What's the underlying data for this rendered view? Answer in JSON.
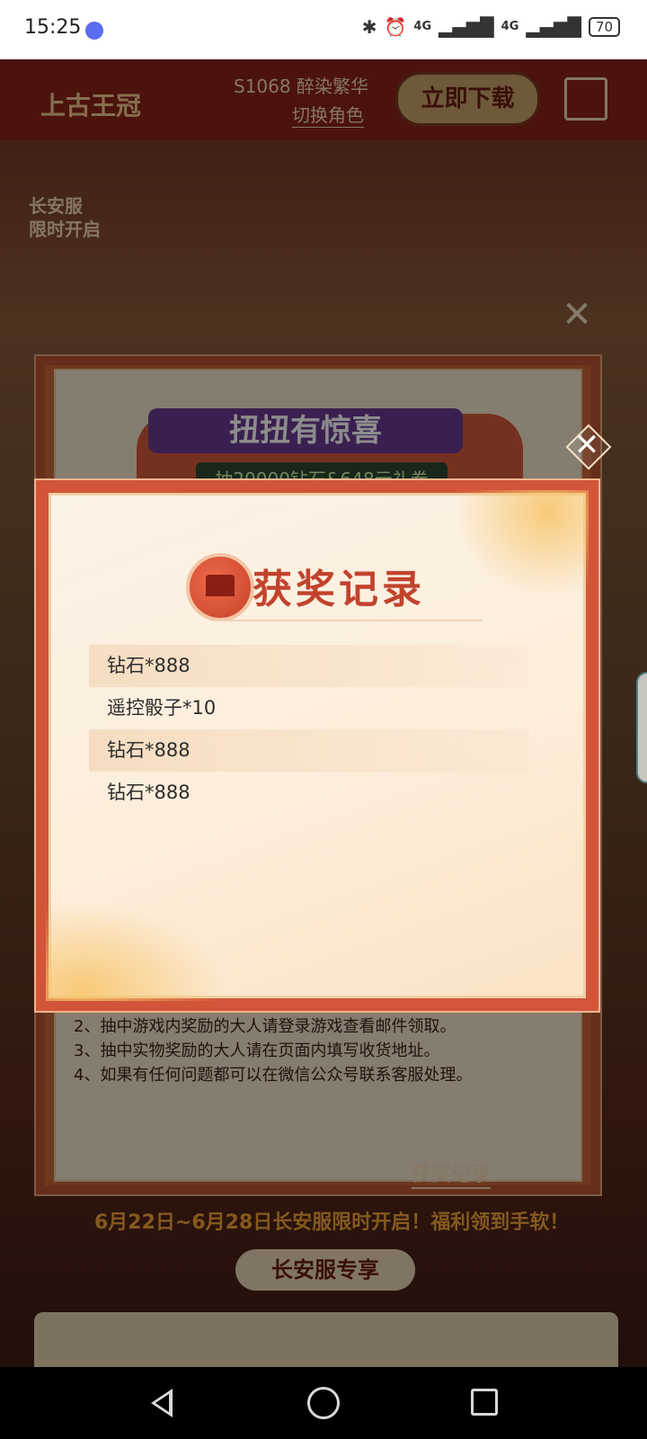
{
  "status_bar": {
    "time": "15:25",
    "battery": "70",
    "network": "4G",
    "icons": [
      "app-icon",
      "bluetooth-icon",
      "alarm-icon",
      "hd-icon",
      "signal-icon",
      "signal-icon",
      "battery-icon"
    ]
  },
  "page": {
    "logo": "上古王冠",
    "server": "S1068 醉染繁华",
    "switch_role": "切换角色",
    "download_button": "立即下载",
    "badge_line1": "长安服",
    "badge_line2": "限时开启",
    "rules": [
      "2、抽中游戏内奖励的大人请登录游戏查看邮件领取。",
      "3、抽中实物奖励的大人请在页面内填写收货地址。",
      "4、如果有任何问题都可以在微信公众号联系客服处理。"
    ],
    "record_link": "获奖记录",
    "banner": "6月22日~6月28日长安服限时开启！福利领到手软！",
    "section_title": "长安服专享"
  },
  "twist_modal": {
    "title": "扭扭有惊喜",
    "subtitle": "抽20000钻石&648元礼券"
  },
  "award_modal": {
    "title": "获奖记录",
    "records": [
      {
        "text": "钻石*888"
      },
      {
        "text": "遥控骰子*10"
      },
      {
        "text": "钻石*888"
      },
      {
        "text": "钻石*888"
      }
    ]
  },
  "colors": {
    "title_red": "#c1432c",
    "frame_red": "#d2553a",
    "stripe": "#f5dbbe"
  }
}
